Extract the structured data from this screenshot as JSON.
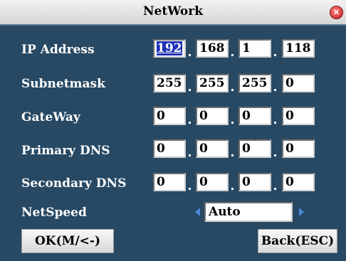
{
  "window": {
    "title": "NetWork",
    "close_icon": "close-icon"
  },
  "rows": [
    {
      "label": "IP Address",
      "fields": [
        "192",
        "168",
        "1",
        "118"
      ]
    },
    {
      "label": "Subnetmask",
      "fields": [
        "255",
        "255",
        "255",
        "0"
      ]
    },
    {
      "label": "GateWay",
      "fields": [
        "0",
        "0",
        "0",
        "0"
      ]
    },
    {
      "label": "Primary DNS",
      "fields": [
        "0",
        "0",
        "0",
        "0"
      ]
    },
    {
      "label": "Secondary DNS",
      "fields": [
        "0",
        "0",
        "0",
        "0"
      ]
    }
  ],
  "netspeed": {
    "label": "NetSpeed",
    "value": "Auto",
    "left_icon": "arrow-left-icon",
    "right_icon": "arrow-right-icon"
  },
  "buttons": {
    "ok_label": "OK(M/<-)",
    "back_label": "Back(ESC)"
  },
  "colors": {
    "background": "#274964",
    "selection": "#1f31b8",
    "arrow": "#4a86d8"
  }
}
